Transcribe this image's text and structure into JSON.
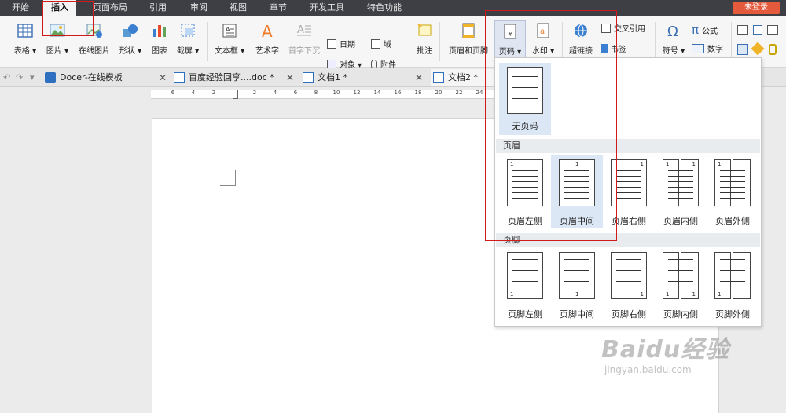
{
  "menu": {
    "items": [
      "开始",
      "插入",
      "页面布局",
      "引用",
      "审阅",
      "视图",
      "章节",
      "开发工具",
      "特色功能"
    ],
    "active": "插入",
    "login": "未登录"
  },
  "ribbon": {
    "table": "表格",
    "picture": "图片",
    "online_picture": "在线图片",
    "shape": "形状",
    "chart": "图表",
    "screenshot": "截屏",
    "textbox": "文本框",
    "wordart": "艺术字",
    "dropcap": "首字下沉",
    "date": "日期",
    "object": "对象",
    "field": "域",
    "attachment": "附件",
    "comment": "批注",
    "header_footer": "页眉和页脚",
    "page_number": "页码",
    "watermark": "水印",
    "hyperlink": "超链接",
    "cross_ref": "交叉引用",
    "bookmark": "书签",
    "symbol": "符号",
    "formula": "公式",
    "number": "数字"
  },
  "tabs": [
    {
      "label": "Docer-在线模板"
    },
    {
      "label": "百度经验回享....doc *"
    },
    {
      "label": "文档1 *"
    },
    {
      "label": "文档2 *"
    }
  ],
  "ruler": [
    "6",
    "4",
    "2",
    "2",
    "4",
    "6",
    "8",
    "10",
    "12",
    "14",
    "16",
    "18",
    "20",
    "22",
    "24"
  ],
  "dropdown": {
    "none_label": "无页码",
    "header_section": "页眉",
    "footer_section": "页脚",
    "header_options": [
      "页眉左侧",
      "页眉中间",
      "页眉右侧",
      "页眉内侧",
      "页眉外侧"
    ],
    "footer_options": [
      "页脚左侧",
      "页脚中间",
      "页脚右侧",
      "页脚内侧",
      "页脚外侧"
    ],
    "page_num": "1"
  },
  "watermark": {
    "main": "Baidu经验",
    "sub": "jingyan.baidu.com"
  },
  "colors": {
    "menubar": "#3d3f45",
    "accent_red": "#d11a1a",
    "login": "#e55a3c",
    "selected": "#dce7f5"
  }
}
